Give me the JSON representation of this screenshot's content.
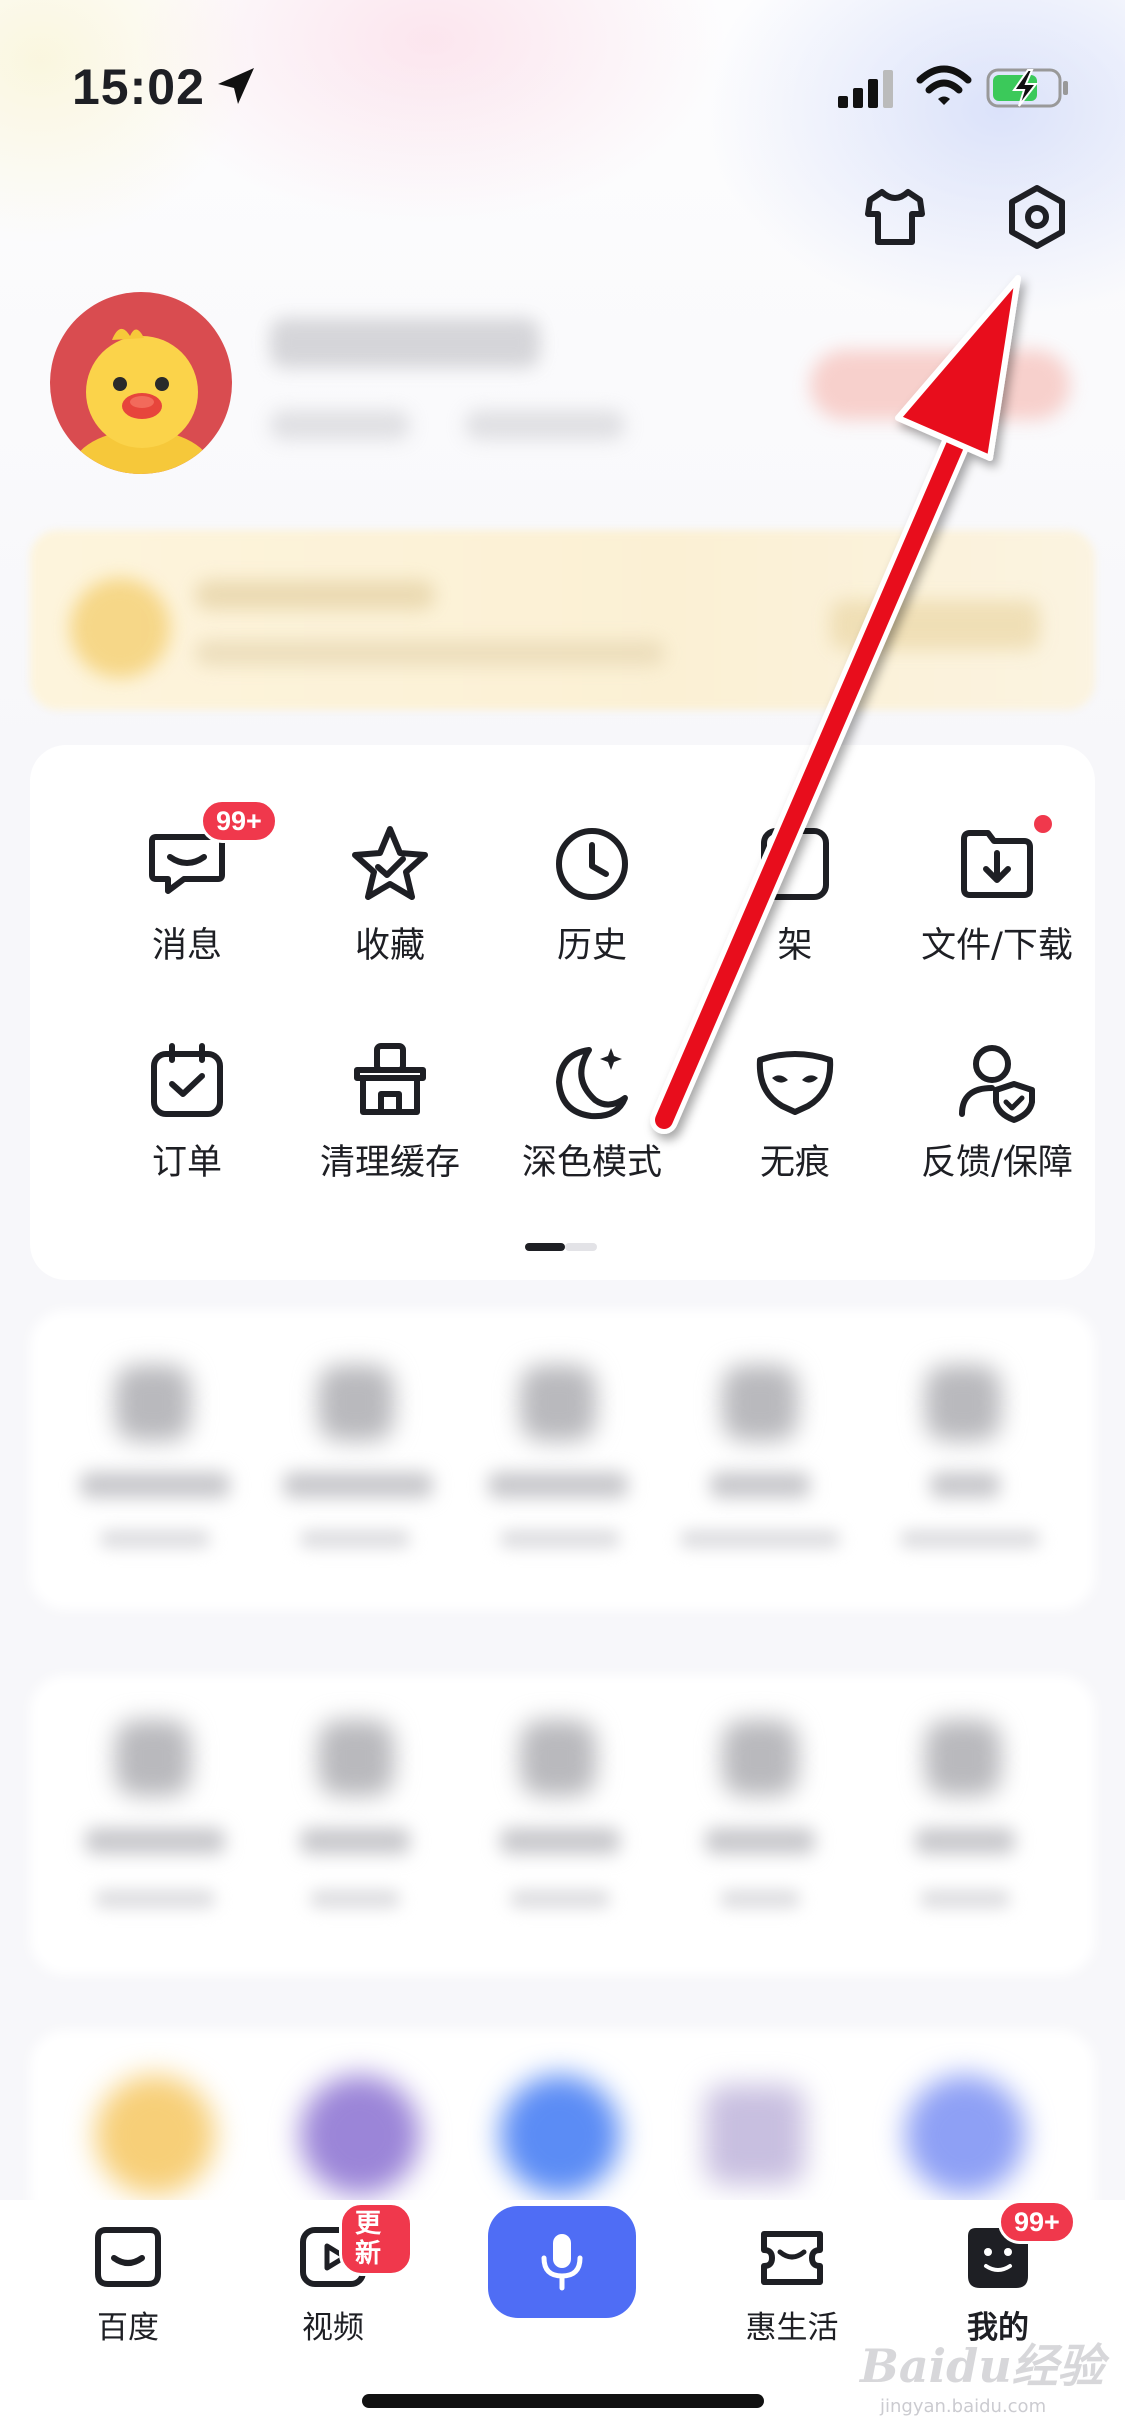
{
  "status_bar": {
    "time": "15:02"
  },
  "header_icons": {
    "skin": "tshirt-icon",
    "settings": "hexagon-gear-icon"
  },
  "tools": [
    {
      "label": "消息",
      "icon": "message-icon",
      "badge": "99+"
    },
    {
      "label": "收藏",
      "icon": "star-icon",
      "badge": ""
    },
    {
      "label": "历史",
      "icon": "clock-icon",
      "badge": ""
    },
    {
      "label": "书架",
      "label_visible": "架",
      "icon": "bookshelf-icon",
      "badge": ""
    },
    {
      "label": "文件/下载",
      "icon": "download-folder-icon",
      "badge": "",
      "dot": true
    },
    {
      "label": "订单",
      "icon": "calendar-check-icon",
      "badge": ""
    },
    {
      "label": "清理缓存",
      "icon": "clean-cache-icon",
      "badge": ""
    },
    {
      "label": "深色模式",
      "icon": "moon-icon",
      "badge": ""
    },
    {
      "label": "无痕",
      "icon": "mask-icon",
      "badge": ""
    },
    {
      "label": "反馈/保障",
      "icon": "user-shield-icon",
      "badge": ""
    }
  ],
  "tab_bar": {
    "items": [
      {
        "label": "百度",
        "icon": "baidu-home-icon"
      },
      {
        "label": "视频",
        "icon": "video-play-icon",
        "badge": "更新"
      },
      {
        "label": "惠生活",
        "icon": "ticket-icon"
      },
      {
        "label": "我的",
        "icon": "profile-face-icon",
        "badge": "99+",
        "active": true
      }
    ],
    "voice": "microphone-icon"
  },
  "watermark": {
    "brand": "Baidu经验",
    "url": "jingyan.baidu.com"
  },
  "colors": {
    "accent": "#4f6df5",
    "badge": "#f0384c",
    "arrow": "#e8101c"
  }
}
